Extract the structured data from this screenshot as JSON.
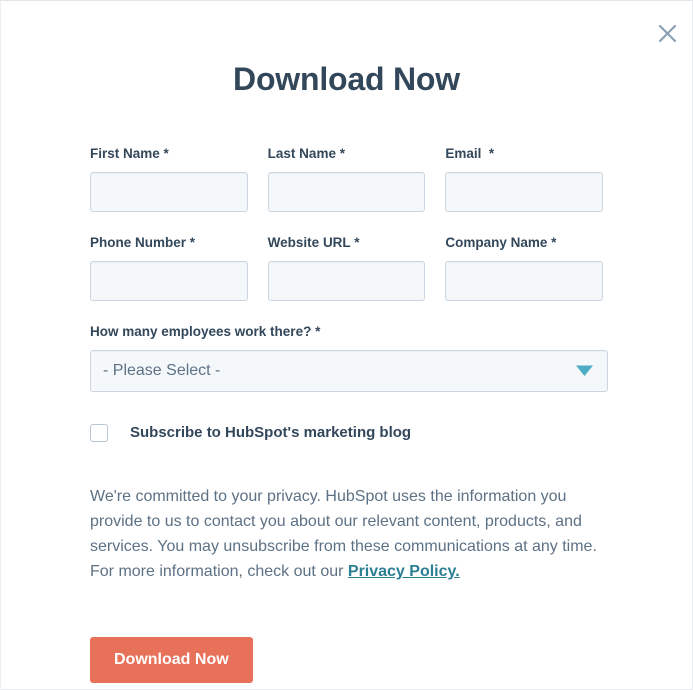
{
  "modal": {
    "title": "Download Now",
    "close_icon": "close-icon",
    "accent_color": "#e8715a",
    "heading_color": "#33475b",
    "link_color": "#2a7f93",
    "input_bg_color": "#f5f8fa",
    "input_border_color": "#cbd6e2",
    "select_arrow_color": "#4eadc4"
  },
  "form": {
    "rows": [
      [
        {
          "label": "First Name",
          "required_mark": "*",
          "value": "",
          "placeholder": "",
          "name": "first-name"
        },
        {
          "label": "Last Name",
          "required_mark": "*",
          "value": "",
          "placeholder": "",
          "name": "last-name"
        },
        {
          "label": "Email ",
          "required_mark": "*",
          "value": "",
          "placeholder": "",
          "name": "email"
        }
      ],
      [
        {
          "label": "Phone Number",
          "required_mark": "*",
          "value": "",
          "placeholder": "",
          "name": "phone-number"
        },
        {
          "label": "Website URL",
          "required_mark": "*",
          "value": "",
          "placeholder": "",
          "name": "website-url"
        },
        {
          "label": "Company Name",
          "required_mark": "*",
          "value": "",
          "placeholder": "",
          "name": "company-name"
        }
      ]
    ],
    "fields": {
      "first_name": {
        "label": "First Name",
        "required_mark": "*",
        "value": "",
        "placeholder": ""
      },
      "last_name": {
        "label": "Last Name",
        "required_mark": "*",
        "value": "",
        "placeholder": ""
      },
      "email": {
        "label": "Email ",
        "required_mark": "*",
        "value": "",
        "placeholder": ""
      },
      "phone_number": {
        "label": "Phone Number",
        "required_mark": "*",
        "value": "",
        "placeholder": ""
      },
      "website_url": {
        "label": "Website URL",
        "required_mark": "*",
        "value": "",
        "placeholder": ""
      },
      "company_name": {
        "label": "Company Name",
        "required_mark": "*",
        "value": "",
        "placeholder": ""
      }
    },
    "employees_select": {
      "label": "How many employees work there?",
      "required_mark": "*",
      "selected": "- Please Select -",
      "options": [
        "- Please Select -"
      ],
      "arrow_icon": "chevron-down-icon"
    },
    "subscribe_checkbox": {
      "label": "Subscribe to HubSpot's marketing blog",
      "checked": false
    },
    "privacy_text_part1": "We're committed to your privacy. HubSpot uses the information you provide to us to contact you about our relevant content, products, and services. You may unsubscribe from these communications at any time. For more information, check out our ",
    "privacy_link_text": "Privacy Policy.",
    "submit_label": "Download Now"
  }
}
